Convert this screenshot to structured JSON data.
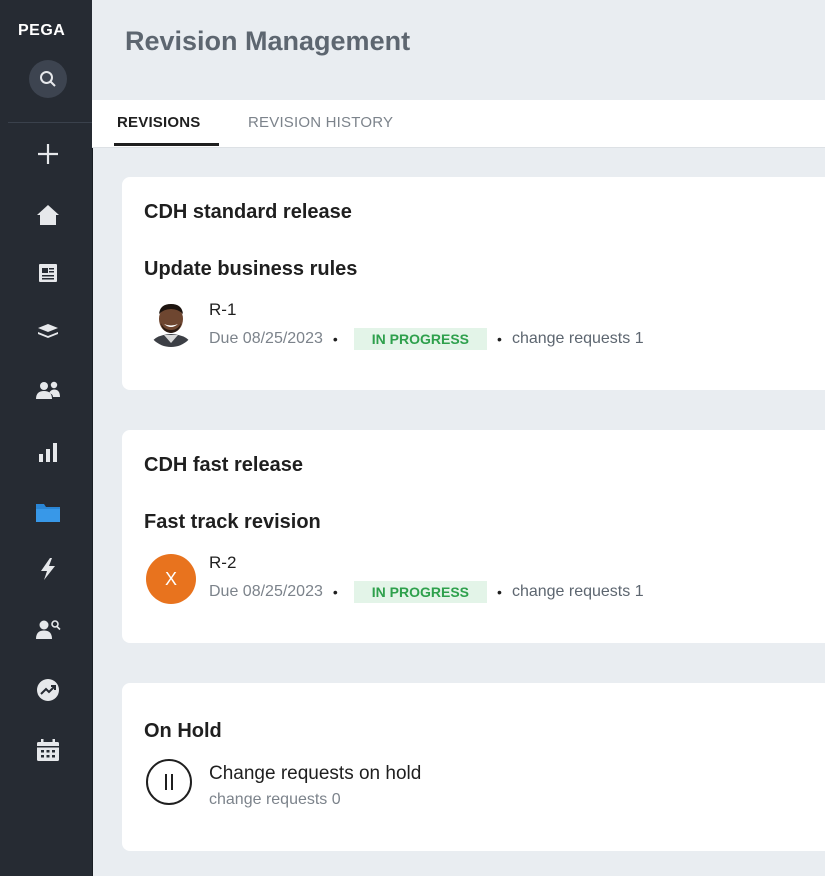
{
  "sidebar": {
    "logo": "PEGA",
    "nav_icons": [
      "plus-icon",
      "home-icon",
      "document-icon",
      "layers-icon",
      "users-icon",
      "bar-chart-icon",
      "folder-icon",
      "lightning-icon",
      "user-search-icon",
      "trend-icon",
      "calendar-icon"
    ],
    "active_icon": "folder-icon",
    "colors": {
      "background": "#262b33",
      "icon": "#e6e8eb",
      "active": "#2a86d6"
    }
  },
  "header": {
    "title": "Revision Management"
  },
  "tabs": [
    {
      "label": "REVISIONS",
      "active": true
    },
    {
      "label": "REVISION HISTORY",
      "active": false
    }
  ],
  "cards": [
    {
      "title": "CDH standard release",
      "revision_name": "Update business rules",
      "id": "R-1",
      "due": "Due 08/25/2023",
      "status": "IN PROGRESS",
      "change_requests": "change requests 1",
      "avatar": "photo"
    },
    {
      "title": "CDH fast release",
      "revision_name": "Fast track revision",
      "id": "R-2",
      "due": "Due 08/25/2023",
      "status": "IN PROGRESS",
      "change_requests": "change requests 1",
      "avatar": "X"
    }
  ],
  "on_hold": {
    "title": "On Hold",
    "label": "Change requests on hold",
    "count": "change requests 0"
  },
  "colors": {
    "status_bg": "#e3f4e8",
    "status_text": "#2ea04c",
    "avatar_orange": "#e8731e"
  }
}
